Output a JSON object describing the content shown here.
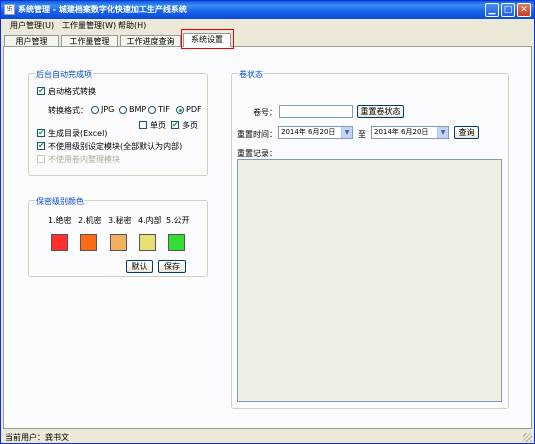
{
  "window": {
    "title": "系统管理 - 城建档案数字化快速加工生产线系统",
    "minimize": "▁",
    "maximize": "□",
    "close": "✕",
    "app_icon": "卐"
  },
  "menu": [
    "用户管理(U)",
    "工作量管理(W)",
    "帮助(H)"
  ],
  "tabs": [
    "用户管理",
    "工作量管理",
    "工作进度查询",
    "系统设置"
  ],
  "active_tab": "系统设置",
  "auto_done": {
    "title": "后台自动完成项",
    "auto_convert": {
      "label": "启动格式转换",
      "checked": true
    },
    "format_label": "转换格式：",
    "formats": [
      {
        "label": "JPG",
        "selected": false
      },
      {
        "label": "BMP",
        "selected": false
      },
      {
        "label": "TIF",
        "selected": false
      },
      {
        "label": "PDF",
        "selected": true
      }
    ],
    "single_page": {
      "label": "单页",
      "checked": false
    },
    "multi_page": {
      "label": "多页",
      "checked": true
    },
    "gen_catalog": {
      "label": "生成目录(Excel)",
      "checked": true
    },
    "no_level_module": {
      "label": "不使用级别设定模块(全部默认为内部)",
      "checked": true
    },
    "no_volume_module": {
      "label": "不使用卷内整理模块",
      "checked": false,
      "disabled": true
    }
  },
  "secret_colors": {
    "title": "保密级别颜色",
    "levels": [
      {
        "label": "1.绝密",
        "color": "#ff2f2f"
      },
      {
        "label": "2.机密",
        "color": "#ff6a14"
      },
      {
        "label": "3.秘密",
        "color": "#f0b060"
      },
      {
        "label": "4.内部",
        "color": "#e8e070"
      },
      {
        "label": "5.公开",
        "color": "#33dd33"
      }
    ],
    "default_button": "默认",
    "save_button": "保存"
  },
  "volume_status": {
    "title": "卷状态",
    "volume_no_label": "卷号：",
    "volume_no_value": "",
    "reset_button": "重置卷状态",
    "reset_time_label": "重置时间：",
    "date_from": "2014年 6月20日",
    "to_label": "至",
    "date_to": "2014年 6月20日",
    "query_button": "查询",
    "reset_log_label": "重置记录："
  },
  "status": {
    "current_user": "当前用户：龚书文"
  }
}
